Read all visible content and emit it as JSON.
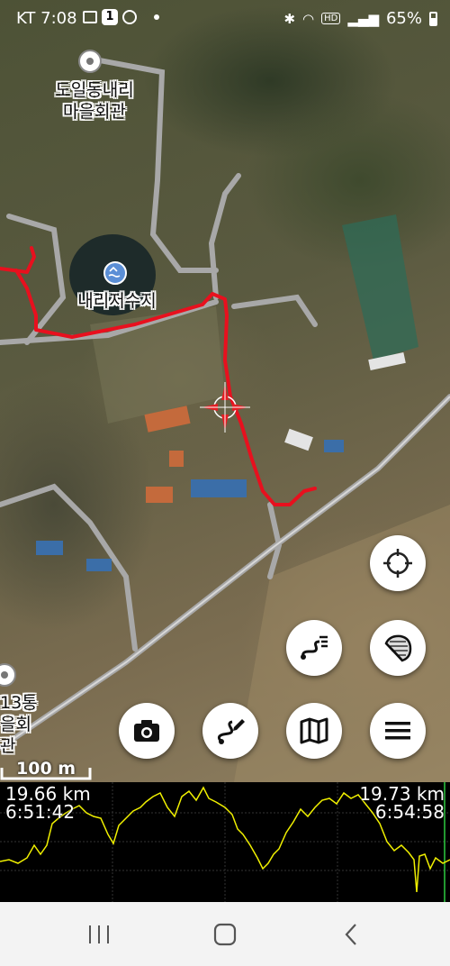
{
  "status_bar": {
    "time": "KT 7:08",
    "battery": "65%"
  },
  "map": {
    "labels": {
      "village_hall_line1": "도일동내리",
      "village_hall_line2": "마을회관",
      "reservoir": "내리저수지",
      "left_hall_line1": "13통",
      "left_hall_line2": "을회관"
    },
    "scale": "100 m",
    "track_color": "#e8101e"
  },
  "buttons": {
    "locate": "crosshair-locate-icon",
    "track_list": "route-list-icon",
    "map_layers": "map-sheet-icon",
    "camera": "camera-icon",
    "record_track": "draw-track-icon",
    "maps": "folded-map-icon",
    "menu": "hamburger-menu-icon"
  },
  "elevation_profile": {
    "left_distance": "19.66 km",
    "left_time": "6:51:42",
    "right_distance": "19.73 km",
    "right_time": "6:54:58",
    "line_color": "#f0f000"
  },
  "nav_bar": {
    "recents": "recents-icon",
    "home": "home-icon",
    "back": "back-icon"
  }
}
